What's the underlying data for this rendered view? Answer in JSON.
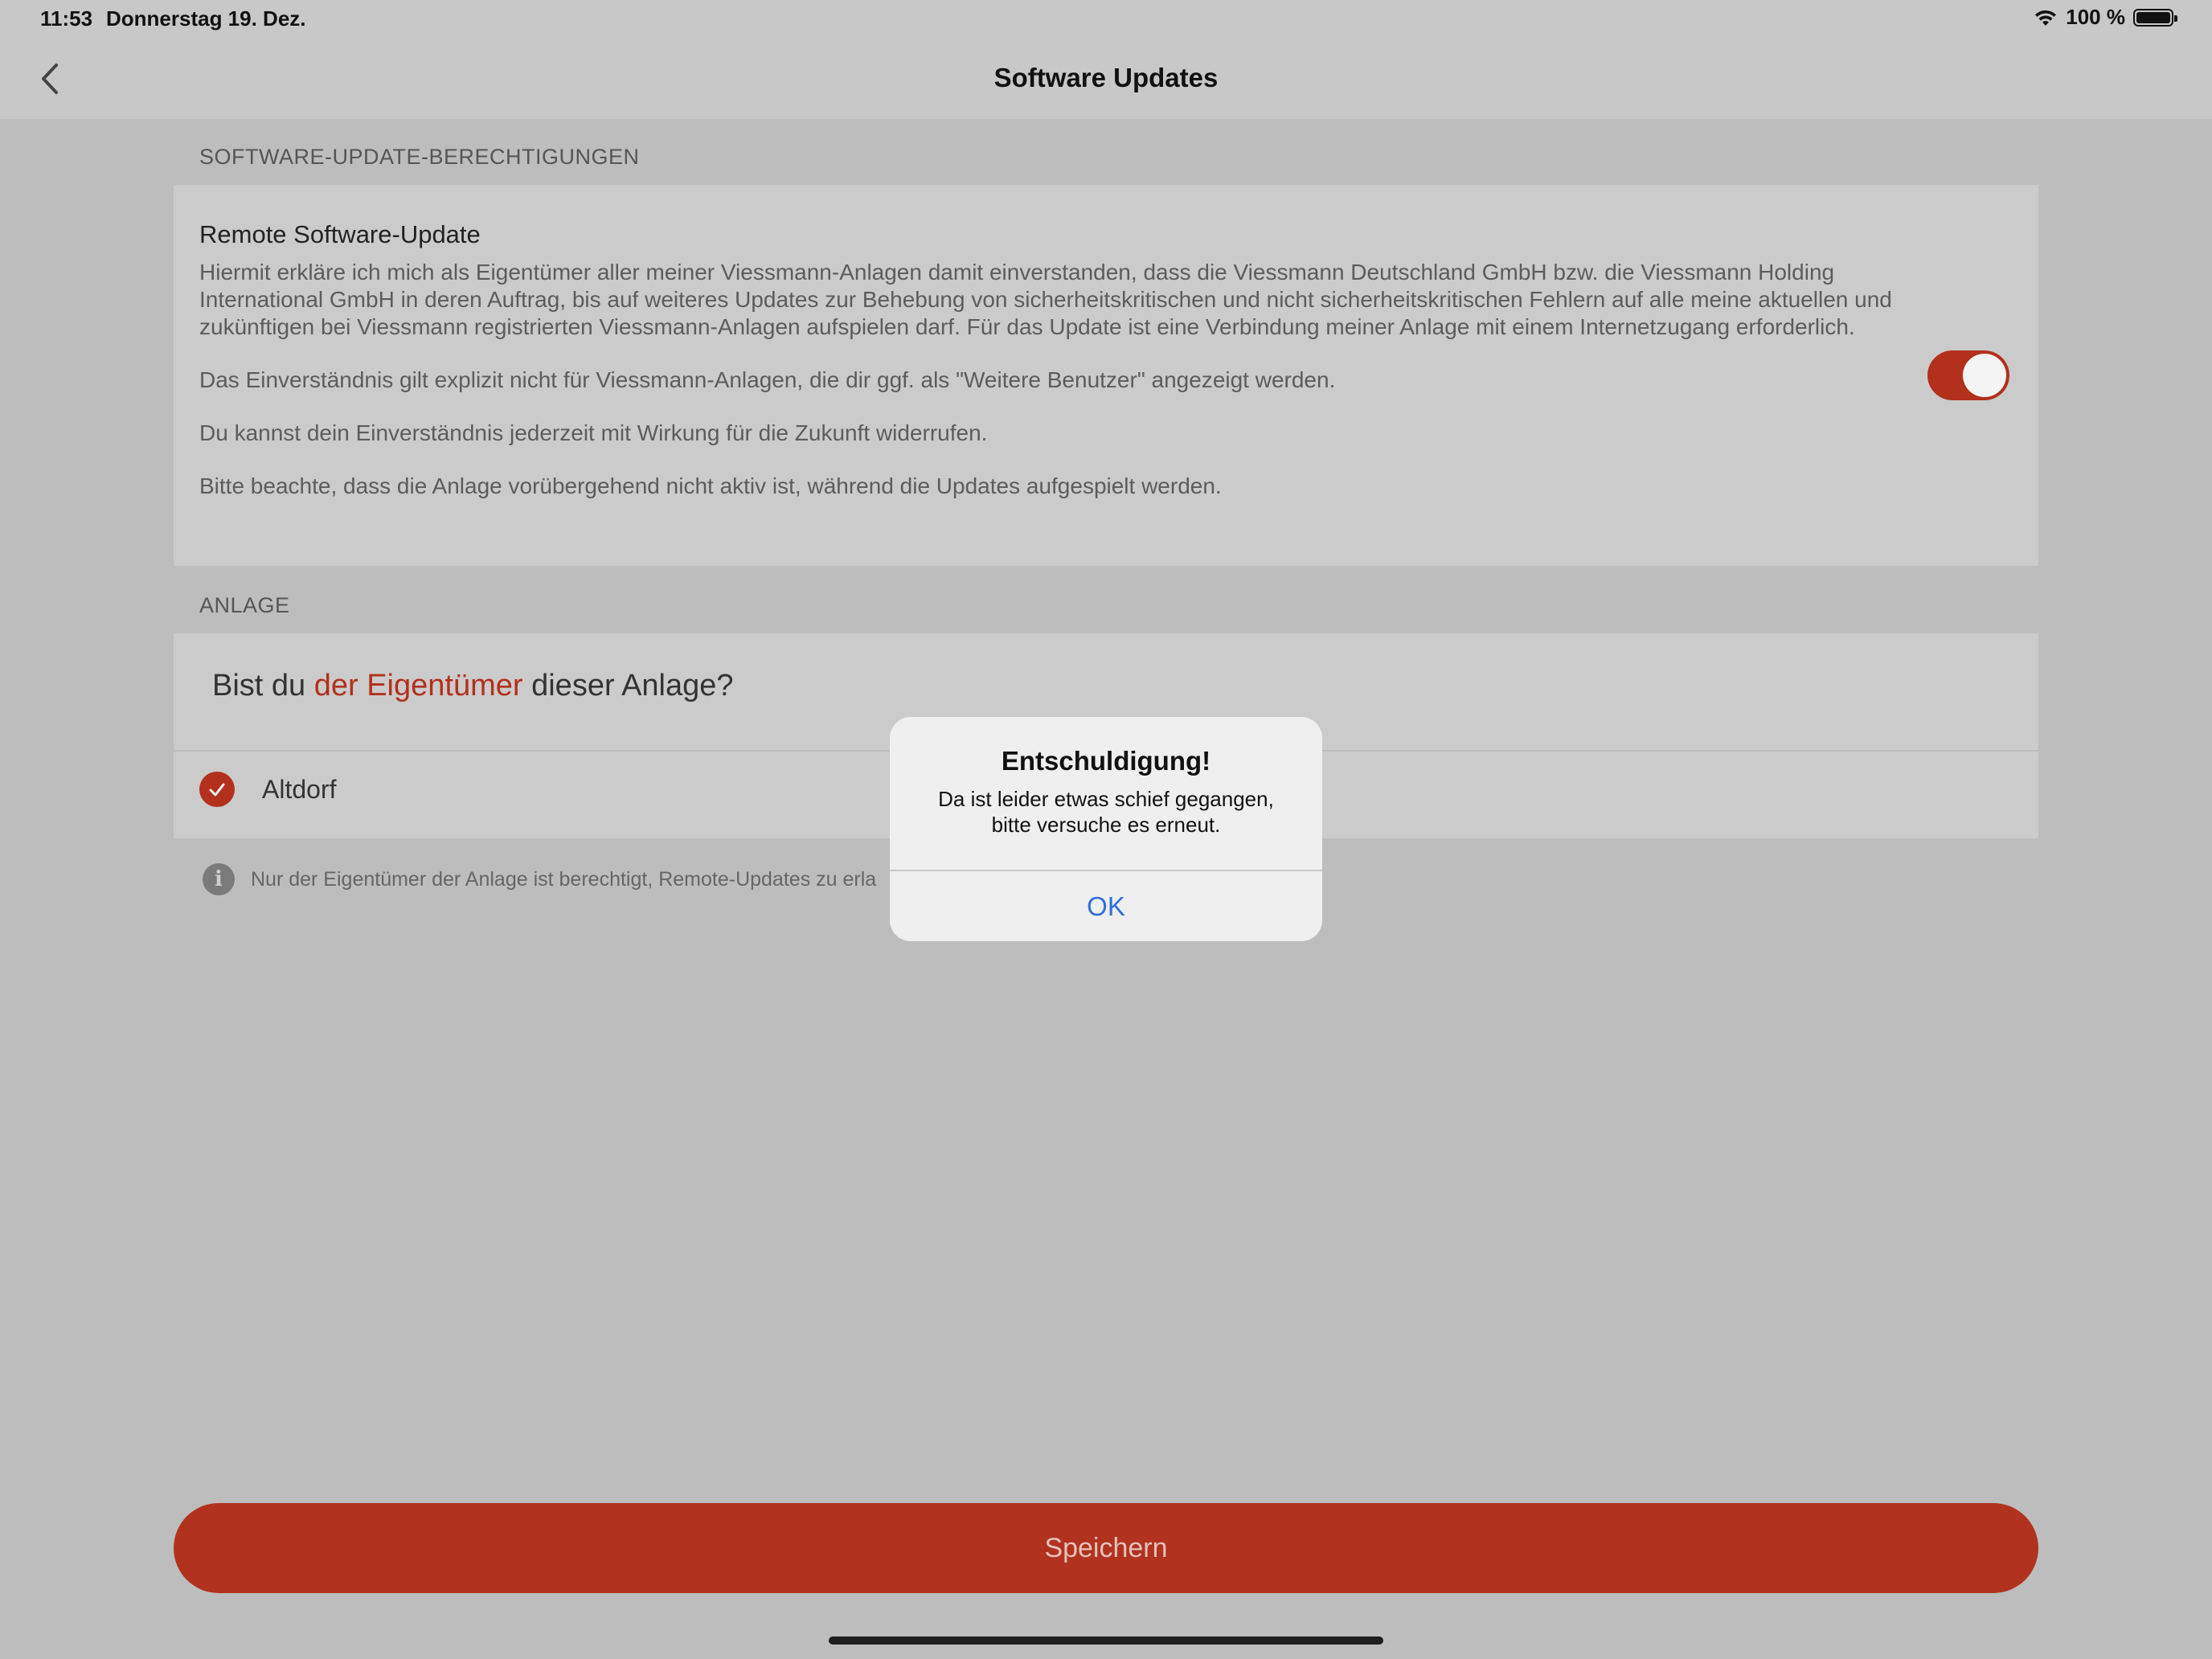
{
  "status_bar": {
    "time": "11:53",
    "date": "Donnerstag 19. Dez.",
    "battery": "100 %"
  },
  "nav": {
    "title": "Software Updates"
  },
  "permissions": {
    "section_header": "SOFTWARE-UPDATE-BERECHTIGUNGEN",
    "title": "Remote Software-Update",
    "paragraphs": [
      "Hiermit erkläre ich mich als Eigentümer aller meiner Viessmann-Anlagen damit einverstanden, dass die Viessmann Deutschland GmbH bzw. die Viessmann Holding International GmbH in deren Auftrag, bis auf weiteres Updates zur Behebung von sicherheitskritischen und nicht sicherheitskritischen Fehlern auf alle meine aktuellen und zukünftigen bei Viessmann registrierten Viessmann-Anlagen aufspielen darf. Für das Update ist eine Verbindung meiner Anlage mit einem Internetzugang erforderlich.",
      "Das Einverständnis gilt explizit nicht für Viessmann-Anlagen, die dir ggf. als \"Weitere Benutzer\" angezeigt werden.",
      "Du kannst dein Einverständnis jederzeit mit Wirkung für die Zukunft  widerrufen.",
      "Bitte beachte, dass die Anlage vorübergehend nicht aktiv ist, während die Updates aufgespielt werden."
    ],
    "toggle_on": true
  },
  "plant": {
    "section_header": "ANLAGE",
    "question_prefix": "Bist du ",
    "question_highlight": "der Eigentümer",
    "question_suffix": " dieser Anlage?",
    "plant_name": "Altdorf",
    "info_text": "Nur der Eigentümer der Anlage ist berechtigt, Remote-Updates zu erla"
  },
  "save_button_label": "Speichern",
  "alert": {
    "title": "Entschuldigung!",
    "message_line1": "Da ist leider etwas schief gegangen,",
    "message_line2": "bitte versuche es erneut.",
    "ok_label": "OK"
  },
  "colors": {
    "accent": "#b2301c",
    "link": "#2f6fdc",
    "background_dimmed": "#bdbdbd"
  }
}
